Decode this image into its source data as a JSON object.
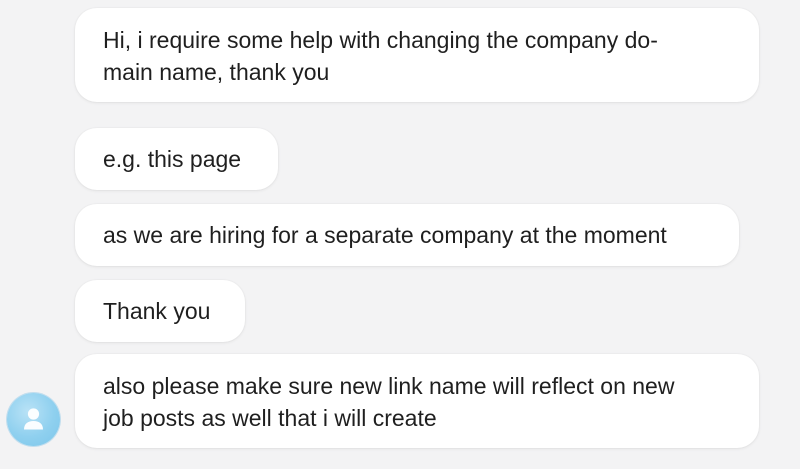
{
  "messages": [
    {
      "text": "Hi, i require some help with changing the company do-\nmain name, thank you"
    },
    {
      "text": "e.g. this page"
    },
    {
      "text": "as we are hiring for a separate company at the moment"
    },
    {
      "text": "Thank you"
    },
    {
      "text": "also please make sure new link name will reflect on new\njob posts as well that i will create"
    }
  ],
  "avatar": {
    "icon": "user-icon",
    "color": "#8fd0ef"
  }
}
